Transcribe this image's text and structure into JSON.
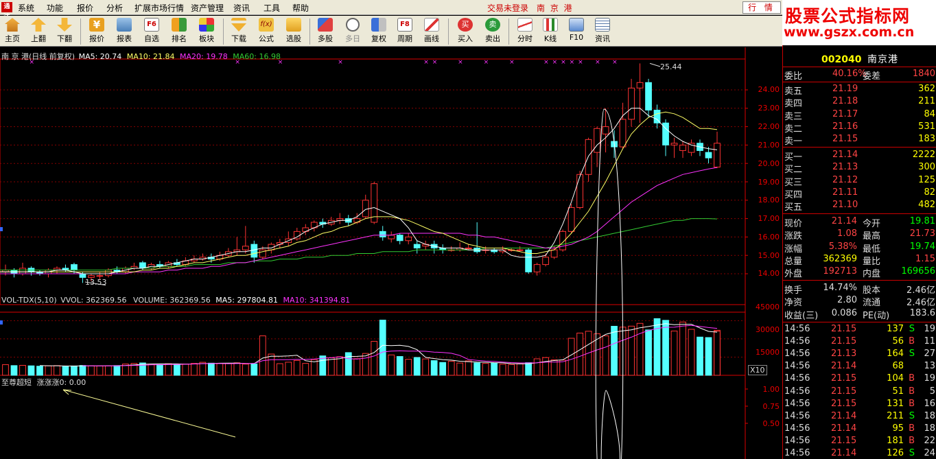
{
  "menubar": {
    "logo": "通达",
    "items": [
      "系统",
      "功能",
      "报价",
      "分析",
      "扩展市场行情",
      "资产管理",
      "资讯",
      "工具",
      "帮助"
    ],
    "login_status": "交易未登录",
    "stock_title": "南 京 港",
    "quote_button": "行 情"
  },
  "watermark": {
    "line1": "股票公式指标网",
    "line2": "www.gszx.com.cn"
  },
  "toolbar": {
    "buttons": [
      {
        "label": "主页",
        "icon": "home-icon"
      },
      {
        "label": "上翻",
        "icon": "arrow-up-icon"
      },
      {
        "label": "下翻",
        "icon": "arrow-down-icon"
      },
      {
        "label": "报价",
        "icon": "yen-icon"
      },
      {
        "label": "报表",
        "icon": "report-icon"
      },
      {
        "label": "自选",
        "icon": "f6-icon"
      },
      {
        "label": "排名",
        "icon": "rank-icon"
      },
      {
        "label": "板块",
        "icon": "sector-icon"
      },
      {
        "label": "下载",
        "icon": "download-icon"
      },
      {
        "label": "公式",
        "icon": "formula-icon"
      },
      {
        "label": "选股",
        "icon": "stock-pick-icon"
      },
      {
        "label": "多股",
        "icon": "multi-stock-icon"
      },
      {
        "label": "多日",
        "icon": "clock-icon"
      },
      {
        "label": "复权",
        "icon": "adjust-icon"
      },
      {
        "label": "周期",
        "icon": "f8-icon"
      },
      {
        "label": "画线",
        "icon": "draw-line-icon"
      },
      {
        "label": "买入",
        "icon": "buy-icon"
      },
      {
        "label": "卖出",
        "icon": "sell-icon"
      },
      {
        "label": "分时",
        "icon": "timeshare-icon"
      },
      {
        "label": "K线",
        "icon": "kline-icon"
      },
      {
        "label": "F10",
        "icon": "f10-icon"
      },
      {
        "label": "资讯",
        "icon": "news-icon"
      }
    ],
    "buy_glyph": "买",
    "sell_glyph": "卖",
    "f6_glyph": "F6",
    "f8_glyph": "F8"
  },
  "main_chart": {
    "title": "南 京 港(日线 前复权)",
    "ma5": "MA5: 20.74",
    "ma10": "MA10: 21.84",
    "ma20": "MA20: 19.78",
    "ma60": "MA60: 16.98",
    "high_mark": "25.44",
    "low_mark": "13.53",
    "price_ticks": [
      "24.00",
      "23.00",
      "22.00",
      "21.00",
      "20.00",
      "19.00",
      "18.00",
      "17.00",
      "16.00",
      "15.00",
      "14.00"
    ]
  },
  "volume_chart": {
    "title": "VOL-TDX(5,10)",
    "vvol": "VVOL: 362369.56",
    "volume": "VOLUME: 362369.56",
    "ma5": "MA5: 297804.81",
    "ma10": "MA10: 341394.81",
    "ticks": [
      "45000",
      "30000",
      "15000"
    ],
    "unit": "X10"
  },
  "indicator_chart": {
    "title": "至尊超短",
    "value": "涨涨涨0: 0.00",
    "ticks": [
      "1.00",
      "0.75",
      "0.50"
    ]
  },
  "chart_data": {
    "type": "candlestick",
    "title": "南 京 港(日线 前复权)",
    "price_range": [
      13.5,
      25.5
    ],
    "candles": [
      {
        "o": 14.1,
        "c": 14.2,
        "h": 14.5,
        "l": 13.9
      },
      {
        "o": 14.2,
        "c": 14.0,
        "h": 14.3,
        "l": 13.8
      },
      {
        "o": 14.0,
        "c": 14.3,
        "h": 14.6,
        "l": 13.9
      },
      {
        "o": 14.3,
        "c": 14.1,
        "h": 14.4,
        "l": 13.9
      },
      {
        "o": 14.1,
        "c": 14.0,
        "h": 14.2,
        "l": 13.9
      },
      {
        "o": 14.0,
        "c": 14.2,
        "h": 14.3,
        "l": 13.8
      },
      {
        "o": 14.2,
        "c": 14.3,
        "h": 14.4,
        "l": 14.0
      },
      {
        "o": 14.3,
        "c": 14.2,
        "h": 14.5,
        "l": 14.1
      },
      {
        "o": 14.5,
        "c": 14.2,
        "h": 14.6,
        "l": 14.0
      },
      {
        "o": 14.0,
        "c": 13.8,
        "h": 14.1,
        "l": 13.5
      },
      {
        "o": 13.8,
        "c": 13.9,
        "h": 14.0,
        "l": 13.6
      },
      {
        "o": 13.9,
        "c": 13.9,
        "h": 14.1,
        "l": 13.7
      },
      {
        "o": 13.9,
        "c": 14.2,
        "h": 14.3,
        "l": 13.8
      },
      {
        "o": 14.2,
        "c": 14.1,
        "h": 14.4,
        "l": 14.0
      },
      {
        "o": 14.1,
        "c": 14.3,
        "h": 14.4,
        "l": 14.0
      },
      {
        "o": 14.3,
        "c": 14.4,
        "h": 14.6,
        "l": 14.2
      },
      {
        "o": 14.6,
        "c": 14.3,
        "h": 14.7,
        "l": 14.2
      },
      {
        "o": 14.3,
        "c": 14.5,
        "h": 14.6,
        "l": 14.2
      },
      {
        "o": 14.5,
        "c": 14.4,
        "h": 14.7,
        "l": 14.3
      },
      {
        "o": 14.4,
        "c": 14.6,
        "h": 14.7,
        "l": 14.3
      },
      {
        "o": 14.6,
        "c": 14.5,
        "h": 14.8,
        "l": 14.4
      },
      {
        "o": 14.5,
        "c": 14.7,
        "h": 14.9,
        "l": 14.4
      },
      {
        "o": 14.7,
        "c": 14.8,
        "h": 15.0,
        "l": 14.6
      },
      {
        "o": 14.8,
        "c": 14.9,
        "h": 15.1,
        "l": 14.7
      },
      {
        "o": 14.9,
        "c": 14.8,
        "h": 15.1,
        "l": 14.6
      },
      {
        "o": 14.8,
        "c": 15.0,
        "h": 15.2,
        "l": 14.7
      },
      {
        "o": 15.0,
        "c": 15.2,
        "h": 15.4,
        "l": 14.9
      },
      {
        "o": 15.2,
        "c": 15.3,
        "h": 16.0,
        "l": 15.0
      },
      {
        "o": 15.3,
        "c": 15.5,
        "h": 16.6,
        "l": 15.1
      },
      {
        "o": 15.6,
        "c": 14.9,
        "h": 15.8,
        "l": 14.6
      },
      {
        "o": 14.9,
        "c": 15.3,
        "h": 15.5,
        "l": 14.8
      },
      {
        "o": 15.3,
        "c": 15.6,
        "h": 15.7,
        "l": 15.1
      },
      {
        "o": 15.6,
        "c": 15.7,
        "h": 15.9,
        "l": 15.4
      },
      {
        "o": 15.7,
        "c": 15.9,
        "h": 16.3,
        "l": 15.5
      },
      {
        "o": 15.9,
        "c": 16.3,
        "h": 16.5,
        "l": 15.8
      },
      {
        "o": 16.3,
        "c": 16.5,
        "h": 16.7,
        "l": 16.1
      },
      {
        "o": 16.5,
        "c": 16.8,
        "h": 16.9,
        "l": 16.3
      },
      {
        "o": 16.8,
        "c": 16.7,
        "h": 17.0,
        "l": 16.5
      },
      {
        "o": 16.7,
        "c": 16.9,
        "h": 17.1,
        "l": 16.6
      },
      {
        "o": 16.9,
        "c": 17.0,
        "h": 17.3,
        "l": 16.7
      },
      {
        "o": 17.0,
        "c": 16.8,
        "h": 17.2,
        "l": 16.6
      },
      {
        "o": 16.8,
        "c": 17.0,
        "h": 17.3,
        "l": 16.7
      },
      {
        "o": 17.1,
        "c": 18.0,
        "h": 18.3,
        "l": 17.0
      },
      {
        "o": 16.8,
        "c": 18.9,
        "h": 19.0,
        "l": 16.7
      },
      {
        "o": 16.3,
        "c": 16.0,
        "h": 16.6,
        "l": 15.8
      },
      {
        "o": 15.9,
        "c": 16.1,
        "h": 16.3,
        "l": 15.7
      },
      {
        "o": 16.1,
        "c": 15.8,
        "h": 16.2,
        "l": 15.6
      },
      {
        "o": 15.8,
        "c": 16.0,
        "h": 16.2,
        "l": 15.6
      },
      {
        "o": 15.6,
        "c": 15.4,
        "h": 15.8,
        "l": 15.1
      },
      {
        "o": 15.5,
        "c": 15.6,
        "h": 15.8,
        "l": 15.3
      },
      {
        "o": 15.6,
        "c": 15.4,
        "h": 15.8,
        "l": 15.1
      },
      {
        "o": 15.4,
        "c": 15.3,
        "h": 15.6,
        "l": 15.1
      },
      {
        "o": 15.3,
        "c": 15.3,
        "h": 15.5,
        "l": 15.2
      },
      {
        "o": 15.3,
        "c": 15.4,
        "h": 15.7,
        "l": 15.2
      },
      {
        "o": 15.4,
        "c": 15.4,
        "h": 15.6,
        "l": 15.3
      },
      {
        "o": 15.4,
        "c": 15.2,
        "h": 16.8,
        "l": 15.1
      },
      {
        "o": 15.3,
        "c": 15.3,
        "h": 15.5,
        "l": 15.1
      },
      {
        "o": 15.3,
        "c": 15.2,
        "h": 15.4,
        "l": 15.1
      },
      {
        "o": 15.2,
        "c": 15.3,
        "h": 15.5,
        "l": 15.1
      },
      {
        "o": 15.3,
        "c": 15.3,
        "h": 15.4,
        "l": 15.2
      },
      {
        "o": 15.3,
        "c": 15.3,
        "h": 15.5,
        "l": 15.2
      },
      {
        "o": 15.3,
        "c": 14.1,
        "h": 15.4,
        "l": 14.0
      },
      {
        "o": 14.1,
        "c": 14.5,
        "h": 14.6,
        "l": 13.9
      },
      {
        "o": 14.5,
        "c": 14.9,
        "h": 15.1,
        "l": 14.4
      },
      {
        "o": 14.9,
        "c": 15.3,
        "h": 15.5,
        "l": 14.8
      },
      {
        "o": 15.3,
        "c": 16.3,
        "h": 16.4,
        "l": 15.2
      },
      {
        "o": 16.3,
        "c": 17.6,
        "h": 17.8,
        "l": 16.2
      },
      {
        "o": 17.6,
        "c": 19.4,
        "h": 19.6,
        "l": 17.5
      },
      {
        "o": 19.4,
        "c": 21.3,
        "h": 21.4,
        "l": 19.0
      },
      {
        "o": 20.6,
        "c": 21.9,
        "h": 22.0,
        "l": 19.8
      },
      {
        "o": 21.6,
        "c": 22.0,
        "h": 23.0,
        "l": 20.6
      },
      {
        "o": 21.2,
        "c": 20.9,
        "h": 21.8,
        "l": 20.3
      },
      {
        "o": 20.9,
        "c": 22.4,
        "h": 23.3,
        "l": 20.8
      },
      {
        "o": 22.4,
        "c": 24.1,
        "h": 24.6,
        "l": 22.0
      },
      {
        "o": 24.1,
        "c": 24.4,
        "h": 25.44,
        "l": 22.2
      },
      {
        "o": 24.4,
        "c": 22.9,
        "h": 24.6,
        "l": 22.5
      },
      {
        "o": 22.9,
        "c": 22.2,
        "h": 23.2,
        "l": 21.9
      },
      {
        "o": 22.2,
        "c": 21.0,
        "h": 22.4,
        "l": 20.4
      },
      {
        "o": 21.0,
        "c": 21.1,
        "h": 21.4,
        "l": 20.3
      },
      {
        "o": 20.7,
        "c": 21.0,
        "h": 21.2,
        "l": 20.3
      },
      {
        "o": 20.6,
        "c": 21.1,
        "h": 21.3,
        "l": 20.4
      },
      {
        "o": 21.1,
        "c": 20.7,
        "h": 21.3,
        "l": 20.4
      },
      {
        "o": 20.6,
        "c": 20.3,
        "h": 20.9,
        "l": 20.0
      },
      {
        "o": 19.8,
        "c": 21.1,
        "h": 21.73,
        "l": 19.74
      }
    ],
    "volumes": [
      8800,
      8000,
      8200,
      7800,
      7500,
      7800,
      8000,
      7200,
      7700,
      8100,
      7900,
      7700,
      7800,
      8000,
      9300,
      9800,
      10200,
      9200,
      8800,
      9600,
      9000,
      9300,
      9800,
      10700,
      10000,
      9800,
      9600,
      10300,
      9200,
      9400,
      32500,
      17500,
      9600,
      10800,
      12200,
      9800,
      12900,
      16000,
      14400,
      15300,
      18700,
      13700,
      18000,
      28000,
      45500,
      16800,
      15500,
      13200,
      14700,
      13500,
      12100,
      10600,
      11600,
      10100,
      11900,
      10200,
      9800,
      10100,
      9100,
      8900,
      9400,
      10400,
      13600,
      14600,
      12700,
      12500,
      30500,
      34800,
      36300,
      34200,
      32500,
      40400,
      39700,
      40500,
      42800,
      37400,
      46700,
      45300,
      36500,
      43900,
      37900,
      31500,
      31100,
      33500,
      34000,
      36200,
      37100,
      36300
    ],
    "volume_range": [
      0,
      52000
    ],
    "ma5": [
      14.1,
      14.1,
      14.1,
      14.1,
      14.1,
      14.1,
      14.1,
      14.2,
      14.2,
      14.1,
      14.0,
      14.0,
      14.0,
      14.0,
      14.1,
      14.2,
      14.3,
      14.3,
      14.4,
      14.4,
      14.5,
      14.6,
      14.7,
      14.8,
      14.8,
      14.9,
      15.0,
      15.1,
      15.2,
      15.2,
      15.3,
      15.4,
      15.4,
      15.6,
      15.8,
      16.0,
      16.3,
      16.5,
      16.7,
      16.8,
      16.9,
      16.9,
      17.1,
      17.5,
      17.6,
      17.4,
      17.2,
      17.0,
      16.5,
      15.8,
      15.6,
      15.5,
      15.4,
      15.4,
      15.4,
      15.3,
      15.3,
      15.3,
      15.3,
      15.3,
      15.0,
      14.9,
      14.9,
      14.9,
      15.0,
      15.7,
      16.7,
      17.9,
      19.3,
      20.4,
      21.0,
      21.4,
      21.9,
      22.6,
      23.0,
      23.0,
      22.6,
      22.4,
      21.9,
      21.5,
      21.2,
      21.0,
      20.9,
      20.8,
      20.74
    ],
    "ma10": [
      14.1,
      14.1,
      14.1,
      14.1,
      14.1,
      14.1,
      14.1,
      14.1,
      14.1,
      14.1,
      14.1,
      14.1,
      14.1,
      14.1,
      14.1,
      14.1,
      14.1,
      14.2,
      14.2,
      14.3,
      14.3,
      14.4,
      14.5,
      14.6,
      14.6,
      14.7,
      14.8,
      14.9,
      15.0,
      15.0,
      15.1,
      15.2,
      15.3,
      15.4,
      15.5,
      15.7,
      15.8,
      16.0,
      16.2,
      16.3,
      16.5,
      16.6,
      16.8,
      17.0,
      17.1,
      17.1,
      17.1,
      17.0,
      16.9,
      16.7,
      16.5,
      16.3,
      16.2,
      16.0,
      15.8,
      15.6,
      15.5,
      15.4,
      15.4,
      15.4,
      15.3,
      15.2,
      15.1,
      15.1,
      15.2,
      15.3,
      15.7,
      16.2,
      16.8,
      17.4,
      18.2,
      19.0,
      19.9,
      20.8,
      21.6,
      22.1,
      22.5,
      22.7,
      22.8,
      22.7,
      22.5,
      22.2,
      21.9,
      21.9,
      21.84
    ],
    "ma20": [
      14.0,
      14.0,
      14.0,
      14.0,
      14.0,
      14.0,
      14.0,
      14.0,
      14.0,
      14.0,
      14.0,
      14.0,
      14.0,
      14.0,
      14.0,
      14.0,
      14.1,
      14.1,
      14.1,
      14.1,
      14.2,
      14.2,
      14.3,
      14.3,
      14.3,
      14.4,
      14.4,
      14.5,
      14.6,
      14.6,
      14.7,
      14.8,
      14.9,
      15.0,
      15.1,
      15.2,
      15.3,
      15.4,
      15.5,
      15.6,
      15.7,
      15.8,
      15.9,
      16.0,
      16.1,
      16.1,
      16.1,
      16.2,
      16.2,
      16.2,
      16.2,
      16.2,
      16.2,
      16.2,
      16.2,
      16.1,
      16.1,
      16.0,
      16.0,
      15.9,
      15.8,
      15.7,
      15.6,
      15.5,
      15.4,
      15.4,
      15.5,
      15.6,
      15.8,
      16.0,
      16.3,
      16.7,
      17.1,
      17.5,
      17.9,
      18.2,
      18.5,
      18.8,
      19.0,
      19.2,
      19.4,
      19.5,
      19.6,
      19.7,
      19.78
    ],
    "ma60": [
      14.2,
      14.2,
      14.2,
      14.2,
      14.2,
      14.2,
      14.2,
      14.2,
      14.2,
      14.2,
      14.2,
      14.2,
      14.2,
      14.2,
      14.3,
      14.3,
      14.3,
      14.3,
      14.3,
      14.4,
      14.4,
      14.4,
      14.4,
      14.5,
      14.5,
      14.5,
      14.5,
      14.6,
      14.6,
      14.6,
      14.7,
      14.7,
      14.7,
      14.8,
      14.8,
      14.8,
      14.9,
      14.9,
      14.9,
      15.0,
      15.0,
      15.0,
      15.1,
      15.1,
      15.1,
      15.2,
      15.2,
      15.2,
      15.2,
      15.3,
      15.3,
      15.3,
      15.3,
      15.3,
      15.3,
      15.3,
      15.3,
      15.4,
      15.4,
      15.4,
      15.4,
      15.4,
      15.4,
      15.4,
      15.4,
      15.5,
      15.6,
      15.7,
      15.8,
      15.9,
      16.0,
      16.1,
      16.2,
      16.3,
      16.4,
      16.5,
      16.6,
      16.7,
      16.8,
      16.9,
      16.9,
      17.0,
      17.0,
      17.0,
      16.98
    ],
    "signal_marks": [
      3,
      27,
      32,
      39,
      49,
      50,
      53,
      56,
      59,
      63,
      64,
      65,
      66,
      67,
      69,
      71
    ]
  },
  "quote_panel": {
    "code": "002040",
    "name": "南京港",
    "weibi_label": "委比",
    "weibi_value": "40.16%",
    "weicha_label": "委差",
    "weicha_value": "1840",
    "sell_levels": [
      {
        "label": "卖五",
        "price": "21.19",
        "vol": "362"
      },
      {
        "label": "卖四",
        "price": "21.18",
        "vol": "211"
      },
      {
        "label": "卖三",
        "price": "21.17",
        "vol": "84"
      },
      {
        "label": "卖二",
        "price": "21.16",
        "vol": "531"
      },
      {
        "label": "卖一",
        "price": "21.15",
        "vol": "183"
      }
    ],
    "buy_levels": [
      {
        "label": "买一",
        "price": "21.14",
        "vol": "2222"
      },
      {
        "label": "买二",
        "price": "21.13",
        "vol": "300"
      },
      {
        "label": "买三",
        "price": "21.12",
        "vol": "125"
      },
      {
        "label": "买四",
        "price": "21.11",
        "vol": "82"
      },
      {
        "label": "买五",
        "price": "21.10",
        "vol": "482"
      }
    ],
    "stats": [
      {
        "l1": "现价",
        "v1": "21.14",
        "c1": "#f44",
        "l2": "今开",
        "v2": "19.81",
        "c2": "#0f0"
      },
      {
        "l1": "涨跌",
        "v1": "1.08",
        "c1": "#f44",
        "l2": "最高",
        "v2": "21.73",
        "c2": "#f44"
      },
      {
        "l1": "涨幅",
        "v1": "5.38%",
        "c1": "#f44",
        "l2": "最低",
        "v2": "19.74",
        "c2": "#0f0"
      },
      {
        "l1": "总量",
        "v1": "362369",
        "c1": "#ff0",
        "l2": "量比",
        "v2": "1.15",
        "c2": "#f44"
      },
      {
        "l1": "外盘",
        "v1": "192713",
        "c1": "#f44",
        "l2": "内盘",
        "v2": "169656",
        "c2": "#0f0"
      }
    ],
    "stats2": [
      {
        "l1": "换手",
        "v1": "14.74%",
        "l2": "股本",
        "v2": "2.46亿"
      },
      {
        "l1": "净资",
        "v1": "2.80",
        "l2": "流通",
        "v2": "2.46亿"
      },
      {
        "l1": "收益(三)",
        "v1": "0.086",
        "l2": "PE(动)",
        "v2": "183.6"
      }
    ],
    "ticks": [
      {
        "t": "14:56",
        "p": "21.15",
        "v": "137",
        "bs": "S",
        "n": "19"
      },
      {
        "t": "14:56",
        "p": "21.15",
        "v": "56",
        "bs": "B",
        "n": "11"
      },
      {
        "t": "14:56",
        "p": "21.13",
        "v": "164",
        "bs": "S",
        "n": "27"
      },
      {
        "t": "14:56",
        "p": "21.14",
        "v": "68",
        "bs": "",
        "n": "13"
      },
      {
        "t": "14:56",
        "p": "21.15",
        "v": "104",
        "bs": "B",
        "n": "19"
      },
      {
        "t": "14:56",
        "p": "21.15",
        "v": "51",
        "bs": "B",
        "n": "5"
      },
      {
        "t": "14:56",
        "p": "21.15",
        "v": "131",
        "bs": "B",
        "n": "16"
      },
      {
        "t": "14:56",
        "p": "21.14",
        "v": "211",
        "bs": "S",
        "n": "18"
      },
      {
        "t": "14:56",
        "p": "21.14",
        "v": "95",
        "bs": "B",
        "n": "18"
      },
      {
        "t": "14:56",
        "p": "21.15",
        "v": "181",
        "bs": "B",
        "n": "22"
      },
      {
        "t": "14:56",
        "p": "21.14",
        "v": "126",
        "bs": "S",
        "n": "24"
      }
    ]
  },
  "colors": {
    "up": "#ff3333",
    "down": "#54ffff",
    "ma5": "#ffffff",
    "ma10": "#ffff66",
    "ma20": "#ff33ff",
    "ma60": "#33cc33",
    "grid": "#880000",
    "axis": "#dd0000"
  }
}
